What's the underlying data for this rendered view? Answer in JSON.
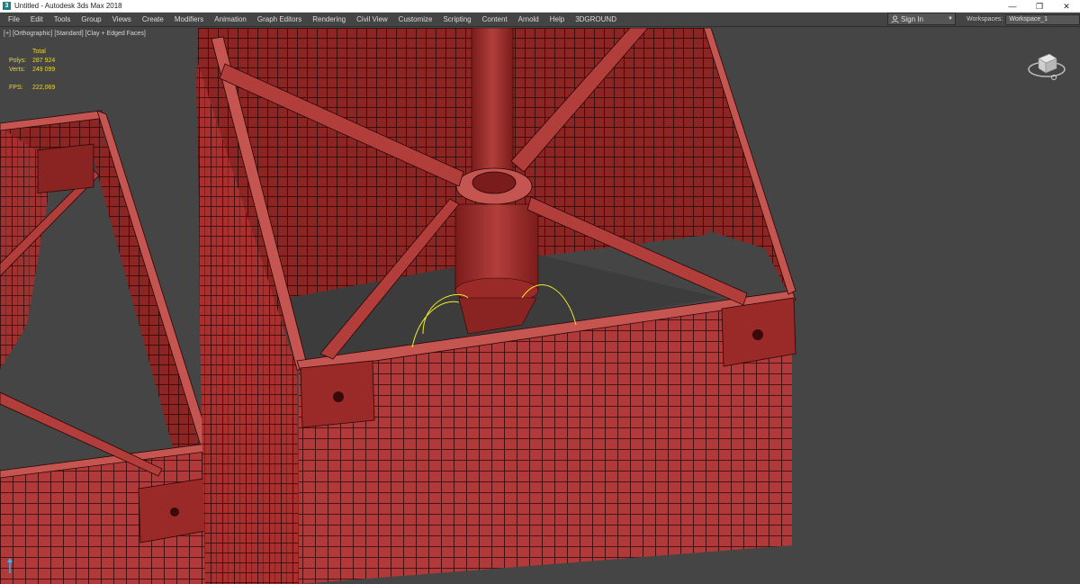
{
  "window": {
    "title": "Untitled - Autodesk 3ds Max 2018",
    "app_icon_letter": "3",
    "controls": {
      "minimize": "—",
      "restore": "❐",
      "close": "✕"
    }
  },
  "menu": {
    "items": [
      "File",
      "Edit",
      "Tools",
      "Group",
      "Views",
      "Create",
      "Modifiers",
      "Animation",
      "Graph Editors",
      "Rendering",
      "Civil View",
      "Customize",
      "Scripting",
      "Content",
      "Arnold",
      "Help",
      "3DGROUND"
    ],
    "signin_label": "Sign In",
    "workspaces_label": "Workspaces:",
    "workspace_value": "Workspace_1"
  },
  "viewport": {
    "labels": [
      "[+]",
      "[Orthographic]",
      "[Standard]",
      "[Clay + Edged Faces]"
    ],
    "stats": {
      "total_label": "Total",
      "polys_label": "Polys:",
      "polys_value": "287 924",
      "verts_label": "Verts:",
      "verts_value": "249 099",
      "fps_label": "FPS:",
      "fps_value": "222,069"
    }
  },
  "colors": {
    "viewport_bg": "#454545",
    "clay": "#a8302f",
    "clay_dark": "#6e1b1a",
    "clay_light": "#c45550",
    "edge": "#2a0605",
    "selection": "#f2ee22",
    "stats_text": "#e8d640"
  },
  "icons": [
    "user-icon",
    "dropdown-arrow-icon",
    "viewcube-icon",
    "axis-gizmo-icon"
  ]
}
